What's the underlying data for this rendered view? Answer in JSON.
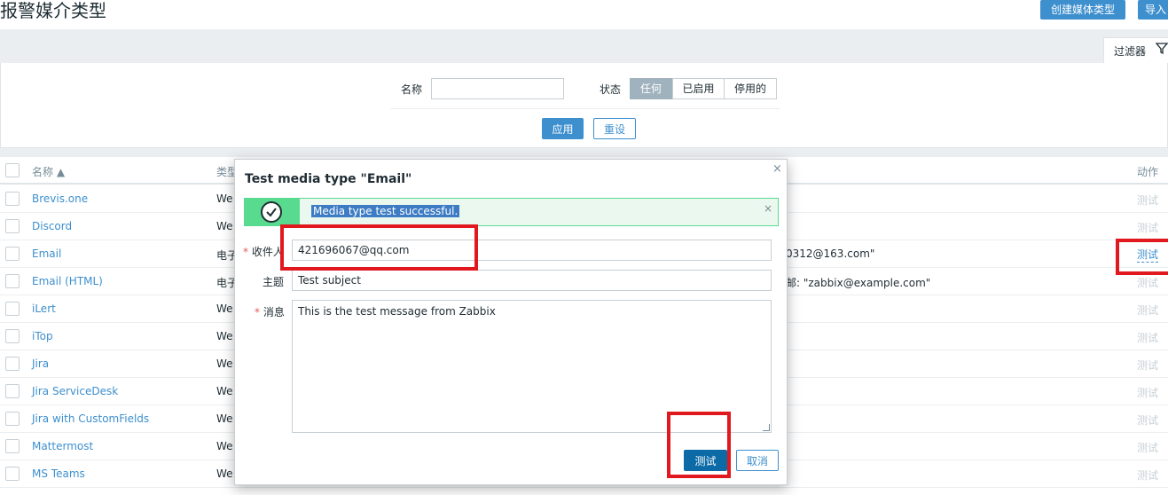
{
  "page": {
    "title": "报警媒介类型",
    "create_button": "创建媒体类型",
    "import_button": "导入"
  },
  "filter": {
    "tab_label": "过滤器",
    "name_label": "名称",
    "name_value": "",
    "status_label": "状态",
    "status_options": [
      "任何",
      "已启用",
      "停用的"
    ],
    "status_selected": "任何",
    "apply_button": "应用",
    "reset_button": "重设"
  },
  "table": {
    "headers": {
      "name": "名称 ▲",
      "type": "类型",
      "action": "动作"
    },
    "rows": [
      {
        "name": "Brevis.one",
        "type": "We",
        "detail": "",
        "action": "测试"
      },
      {
        "name": "Discord",
        "type": "We",
        "detail": "",
        "action": "测试"
      },
      {
        "name": "Email",
        "type": "电子",
        "detail": "0312@163.com\"",
        "action": "测试"
      },
      {
        "name": "Email (HTML)",
        "type": "电子",
        "detail": "邮: \"zabbix@example.com\"",
        "action": "测试"
      },
      {
        "name": "iLert",
        "type": "We",
        "detail": "",
        "action": "测试"
      },
      {
        "name": "iTop",
        "type": "We",
        "detail": "",
        "action": "测试"
      },
      {
        "name": "Jira",
        "type": "We",
        "detail": "",
        "action": "测试"
      },
      {
        "name": "Jira ServiceDesk",
        "type": "We",
        "detail": "",
        "action": "测试"
      },
      {
        "name": "Jira with CustomFields",
        "type": "We",
        "detail": "",
        "action": "测试"
      },
      {
        "name": "Mattermost",
        "type": "We",
        "detail": "",
        "action": "测试"
      },
      {
        "name": "MS Teams",
        "type": "We",
        "detail": "",
        "action": "测试"
      }
    ]
  },
  "dialog": {
    "title": "Test media type \"Email\"",
    "close_glyph": "×",
    "message": "Media type test successful.",
    "message_close_glyph": "×",
    "send_to_label": "收件人",
    "send_to_value": "421696067@qq.com",
    "subject_label": "主题",
    "subject_value": "Test subject",
    "message_label": "消息",
    "message_value": "This is the test message from Zabbix",
    "test_button": "测试",
    "cancel_button": "取消",
    "required_mark": "*"
  },
  "colors": {
    "accent": "#3d8fce",
    "success": "#59db8f",
    "highlight": "#e1191f"
  }
}
